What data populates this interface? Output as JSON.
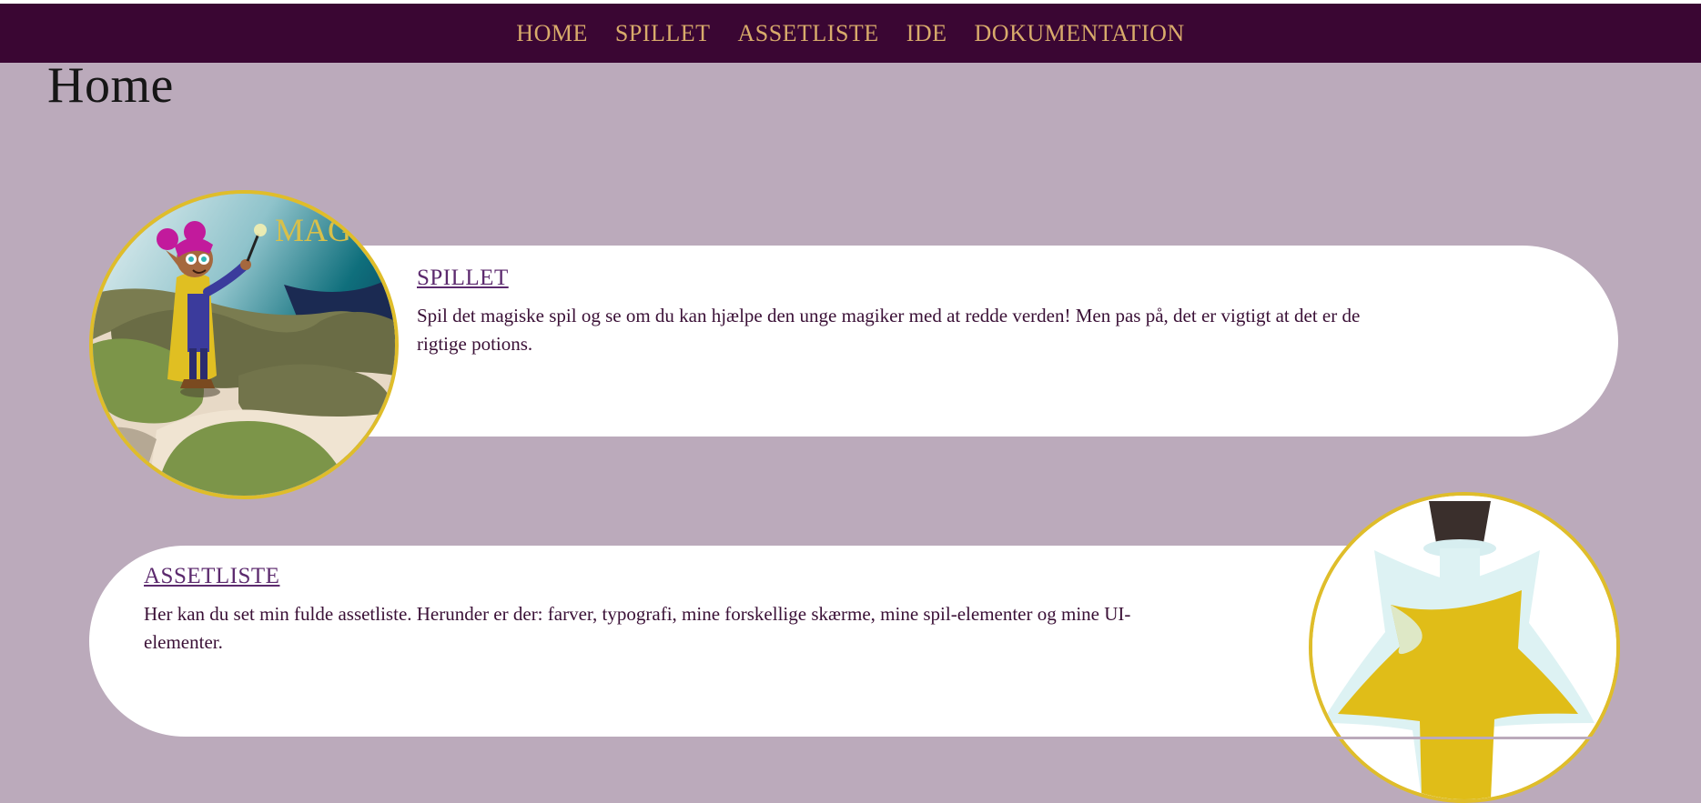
{
  "nav": {
    "items": [
      {
        "label": "HOME"
      },
      {
        "label": "SPILLET"
      },
      {
        "label": "ASSETLISTE"
      },
      {
        "label": "IDE"
      },
      {
        "label": "DOKUMENTATION"
      }
    ]
  },
  "page": {
    "title": "Home"
  },
  "cards": [
    {
      "link": "SPILLET",
      "text": "Spil det magiske spil og se om du kan hjælpe den unge magiker med at redde verden! Men pas på, det er vigtigt at det er de rigtige potions."
    },
    {
      "link": "ASSETLISTE",
      "text": "Her kan du set min fulde assetliste. Herunder er der: farver, typografi, mine forskellige skærme, mine spil-elementer og mine UI-elementer."
    }
  ],
  "images": {
    "game_image_logo_text": "MAG"
  },
  "colors": {
    "nav_background": "#3a0633",
    "nav_text": "#d8ab6b",
    "page_background": "#bbaabb",
    "card_background": "#ffffff",
    "circle_border": "#dfbd2a",
    "link_color": "#5c2a6e"
  }
}
